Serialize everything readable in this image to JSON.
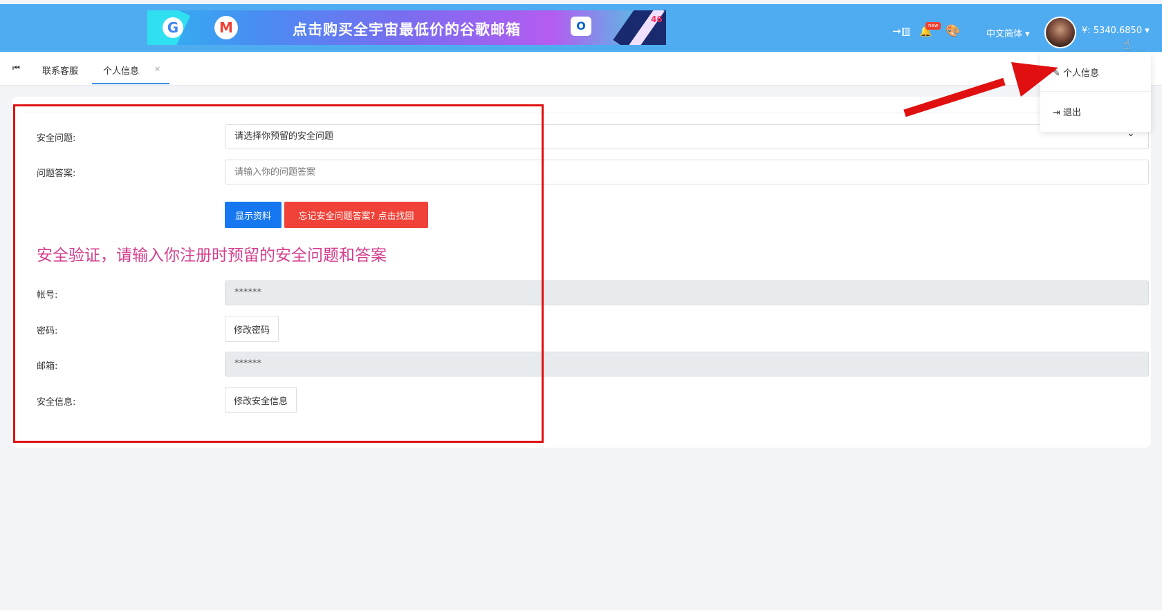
{
  "banner": {
    "text": "点击购买全宇宙最低价的谷歌邮箱",
    "g_letter": "G",
    "m_letter": "M",
    "o_letter": "O",
    "badge": "46"
  },
  "topbar": {
    "transfer_icon": "→▥",
    "bell_icon": "🔔",
    "new_badge": "new",
    "palette_icon": "🎨",
    "language": "中文简体 ▾",
    "balance": "¥:  5340.6850 ▾",
    "cursor_icon": "☝"
  },
  "tabs": {
    "first_icon": "⏮",
    "contact": "联系客服",
    "profile": "个人信息",
    "close": "×"
  },
  "form": {
    "security_question_label": "安全问题:",
    "security_question_value": "请选择你预留的安全问题",
    "answer_label": "问题答案:",
    "answer_placeholder": "请输入你的问题答案",
    "show_button": "显示资料",
    "forgot_button": "忘记安全问题答案? 点击找回",
    "heading": "安全验证，请输入你注册时预留的安全问题和答案",
    "account_label": "帐号:",
    "account_value": "******",
    "password_label": "密码:",
    "change_password_button": "修改密码",
    "email_label": "邮箱:",
    "email_value": "******",
    "security_info_label": "安全信息:",
    "change_security_button": "修改安全信息"
  },
  "dropdown": {
    "profile": "个人信息",
    "profile_icon": "✎",
    "logout": "退出",
    "logout_icon": "⇥"
  },
  "colors": {
    "topbar": "#50acf0",
    "primary": "#1677f0",
    "danger": "#f04238",
    "heading": "#d43f8e",
    "annotation": "#e01010"
  }
}
